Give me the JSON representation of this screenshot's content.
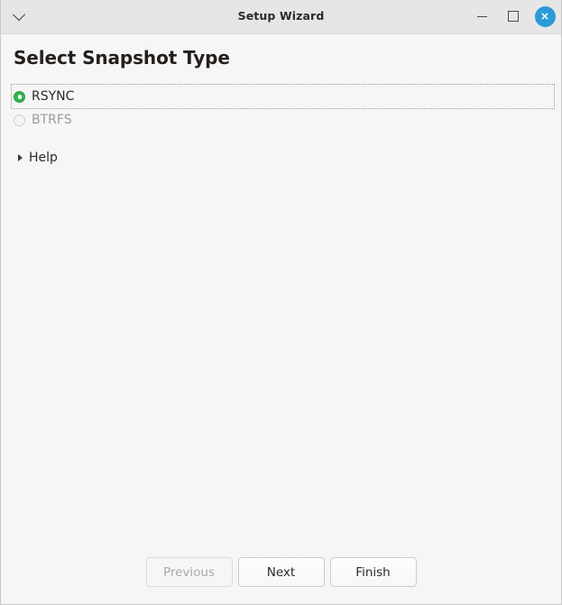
{
  "window": {
    "titlebar": {
      "title": "Setup Wizard",
      "menu_icon": "chevron-down-icon",
      "minimize_label": "Minimize",
      "maximize_label": "Maximize",
      "close_label": "Close",
      "close_color": "#2a9bd8",
      "background": "#e6e6e6"
    },
    "background": "#f6f6f6"
  },
  "page": {
    "title": "Select Snapshot Type",
    "options": [
      {
        "label": "RSYNC",
        "selected": true,
        "disabled": false,
        "focused": true,
        "accent": "#2eb64e"
      },
      {
        "label": "BTRFS",
        "selected": false,
        "disabled": true,
        "focused": false,
        "accent": "#cfcfcf"
      }
    ],
    "help": {
      "label": "Help",
      "expanded": false,
      "icon": "triangle-right-icon"
    }
  },
  "footer": {
    "buttons": [
      {
        "label": "Previous",
        "disabled": true
      },
      {
        "label": "Next",
        "disabled": false
      },
      {
        "label": "Finish",
        "disabled": false
      }
    ]
  }
}
